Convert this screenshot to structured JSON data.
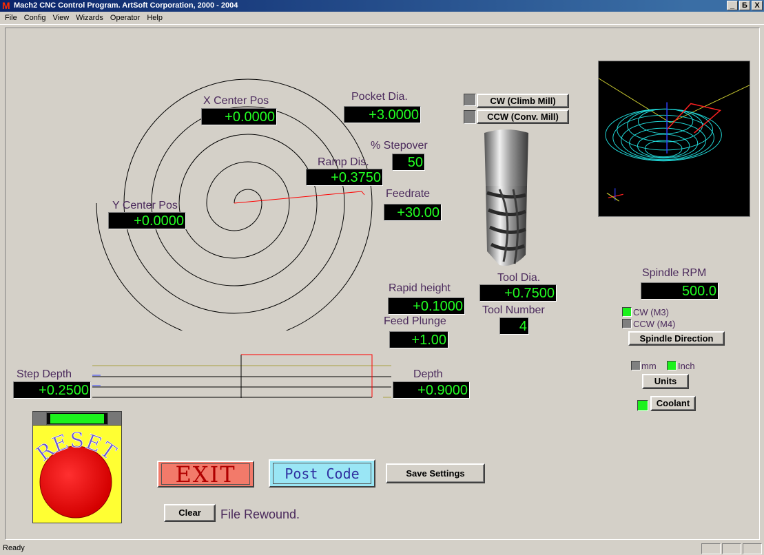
{
  "window": {
    "title": "Mach2 CNC Control Program. ArtSoft Corporation, 2000 - 2004",
    "app_icon": "M",
    "controls": [
      "_",
      "Б",
      "X"
    ]
  },
  "menu": [
    "File",
    "Config",
    "View",
    "Wizards",
    "Operator",
    "Help"
  ],
  "fields": {
    "x_center_pos": {
      "label": "X Center Pos",
      "value": "+0.0000"
    },
    "pocket_dia": {
      "label": "Pocket Dia.",
      "value": "+3.0000"
    },
    "stepover": {
      "label": "% Stepover",
      "value": "50"
    },
    "ramp_dis": {
      "label": "Ramp Dis.",
      "value": "+0.3750"
    },
    "feedrate": {
      "label": "Feedrate",
      "value": "+30.00"
    },
    "y_center_pos": {
      "label": "Y Center Pos",
      "value": "+0.0000"
    },
    "rapid_height": {
      "label": "Rapid height",
      "value": "+0.1000"
    },
    "feed_plunge": {
      "label": "Feed Plunge",
      "value": "+1.00"
    },
    "tool_dia": {
      "label": "Tool Dia.",
      "value": "+0.7500"
    },
    "tool_number": {
      "label": "Tool Number",
      "value": "4"
    },
    "spindle_rpm": {
      "label": "Spindle RPM",
      "value": "500.0"
    },
    "step_depth": {
      "label": "Step Depth",
      "value": "+0.2500"
    },
    "depth": {
      "label": "Depth",
      "value": "+0.9000"
    }
  },
  "mill_direction": {
    "cw_label": "CW (Climb Mill)",
    "ccw_label": "CCW (Conv. Mill)",
    "cw_on": false,
    "ccw_on": false
  },
  "spindle": {
    "cw_label": "CW (M3)",
    "ccw_label": "CCW (M4)",
    "cw_on": true,
    "ccw_on": false,
    "direction_button": "Spindle Direction"
  },
  "units": {
    "mm_label": "mm",
    "inch_label": "Inch",
    "mm_on": false,
    "inch_on": true,
    "button": "Units"
  },
  "coolant": {
    "button": "Coolant",
    "on": true
  },
  "reset": {
    "label": "RESET"
  },
  "actions": {
    "exit": "EXIT",
    "post_code": "Post Code",
    "save_settings": "Save Settings",
    "clear": "Clear"
  },
  "message": "File Rewound.",
  "status": "Ready",
  "colors": {
    "dro_background": "#000000",
    "dro_text": "#22ff22",
    "label_text": "#4b2a5c",
    "led_on": "#1cf21c",
    "led_off": "#808080",
    "toolpath": "#ff0000",
    "exit_button": "#f27a6a",
    "post_code_button": "#9ae6f5",
    "reset_panel": "#ffff33",
    "reset_button": "#ff1a1a"
  },
  "icons": [
    "spiral-toolpath-graphic",
    "end-mill-tool-image",
    "toolpath-3d-preview",
    "depth-profile-graphic",
    "reset-estop-icon"
  ]
}
